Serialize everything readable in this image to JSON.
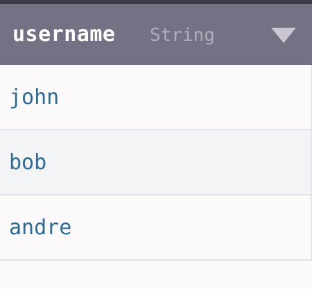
{
  "header": {
    "column_name": "username",
    "column_type": "String",
    "sort_icon": "triangle-down-icon"
  },
  "rows": [
    {
      "username": "john"
    },
    {
      "username": "bob"
    },
    {
      "username": "andre"
    }
  ],
  "colors": {
    "header_bg": "#757185",
    "top_strip": "#3c3a49",
    "cell_text": "#2e6a96",
    "row_alt_bg": "#f3f4f6",
    "row_bg": "#fcf9fa"
  }
}
